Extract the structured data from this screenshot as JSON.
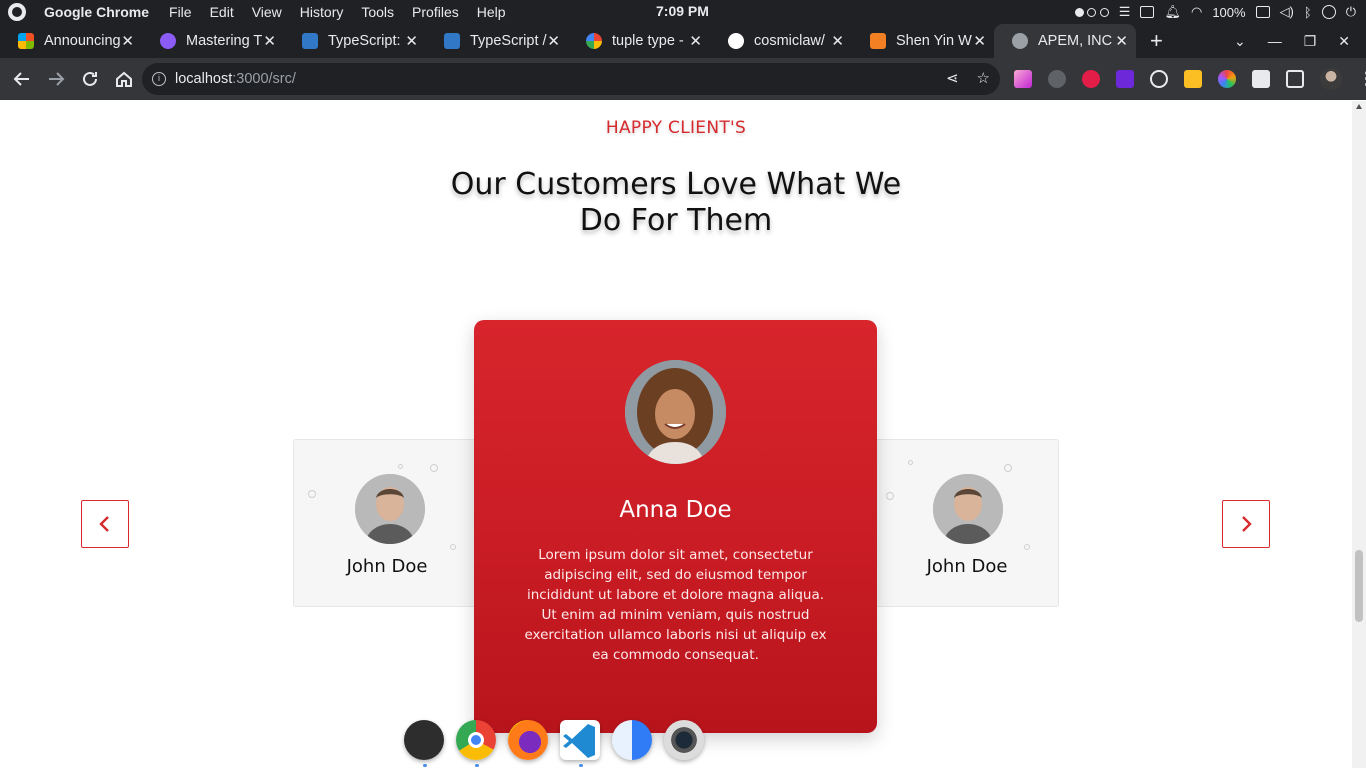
{
  "os": {
    "app_name": "Google Chrome",
    "menus": [
      "File",
      "Edit",
      "View",
      "History",
      "Tools",
      "Profiles",
      "Help"
    ],
    "clock": "7:09 PM",
    "battery": "100%"
  },
  "tabs": [
    {
      "title": "Announcing",
      "favicon_color": "#f25022"
    },
    {
      "title": "Mastering T",
      "favicon_color": "#8b5cf6"
    },
    {
      "title": "TypeScript:",
      "favicon_color": "#3178c6"
    },
    {
      "title": "TypeScript /",
      "favicon_color": "#3178c6"
    },
    {
      "title": "tuple type -",
      "favicon_color": "#ffffff"
    },
    {
      "title": "cosmiclaw/",
      "favicon_color": "#ffffff"
    },
    {
      "title": "Shen Yin W",
      "favicon_color": "#f48024"
    },
    {
      "title": "APEM, INC",
      "favicon_color": "#9aa0a6",
      "active": true
    }
  ],
  "toolbar": {
    "url_host": "localhost",
    "url_path": ":3000/src/",
    "back_icon": "arrow-left-icon",
    "forward_icon": "arrow-right-icon",
    "reload_icon": "reload-icon",
    "home_icon": "home-icon"
  },
  "section": {
    "eyebrow": "HAPPY CLIENT'S",
    "headline": "Our Customers Love What We Do For Them"
  },
  "testimonials": {
    "left": {
      "name": "John Doe"
    },
    "center": {
      "name": "Anna Doe",
      "quote": "Lorem ipsum dolor sit amet, consectetur adipiscing elit, sed do eiusmod tempor incididunt ut labore et dolore magna aliqua. Ut enim ad minim veniam, quis nostrud exercitation ullamco laboris nisi ut aliquip ex ea commodo consequat."
    },
    "right": {
      "name": "John Doe"
    }
  },
  "colors": {
    "accent": "#d62a2e",
    "card_gradient_top": "#d8252c",
    "card_gradient_bottom": "#b8141c"
  },
  "dock": [
    "terminal",
    "chrome",
    "firefox",
    "vscode",
    "finder",
    "camera"
  ]
}
